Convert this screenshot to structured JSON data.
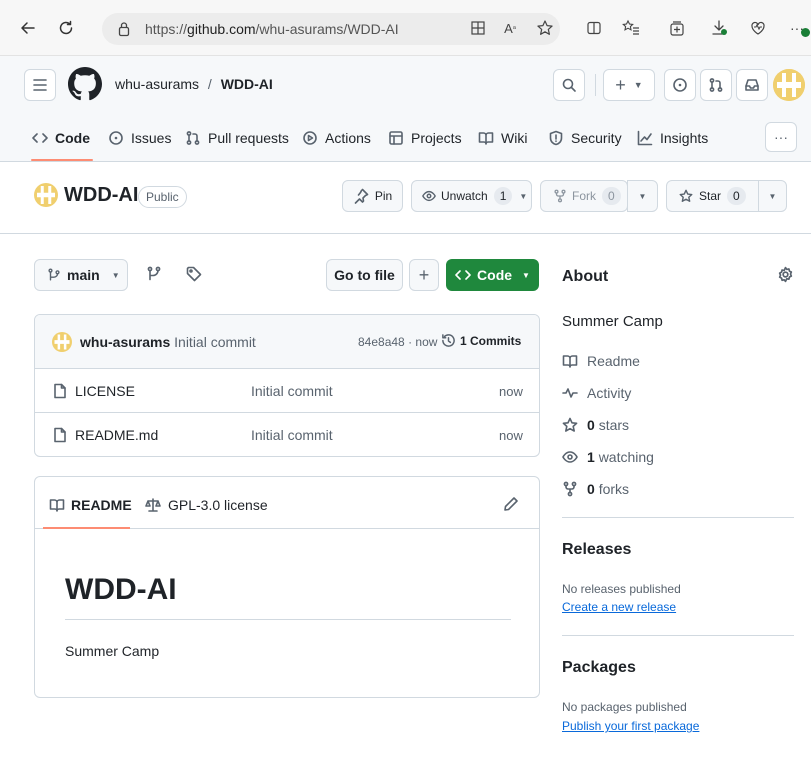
{
  "browser": {
    "url_prefix": "https://",
    "url_host": "github.com",
    "url_path": "/whu-asurams/WDD-AI"
  },
  "header": {
    "owner": "whu-asurams",
    "separator": "/",
    "repo": "WDD-AI"
  },
  "tabs": [
    {
      "label": "Code",
      "icon": "code-icon"
    },
    {
      "label": "Issues",
      "icon": "issue-icon"
    },
    {
      "label": "Pull requests",
      "icon": "pull-request-icon"
    },
    {
      "label": "Actions",
      "icon": "play-icon"
    },
    {
      "label": "Projects",
      "icon": "table-icon"
    },
    {
      "label": "Wiki",
      "icon": "book-icon"
    },
    {
      "label": "Security",
      "icon": "shield-icon"
    },
    {
      "label": "Insights",
      "icon": "graph-icon"
    }
  ],
  "repo": {
    "name": "WDD-AI",
    "visibility": "Public",
    "pin_label": "Pin",
    "unwatch_label": "Unwatch",
    "watch_count": "1",
    "fork_label": "Fork",
    "fork_count": "0",
    "star_label": "Star",
    "star_count": "0"
  },
  "toolbar": {
    "branch": "main",
    "go_to_file": "Go to file",
    "add_label": "+",
    "code_label": "Code"
  },
  "commit": {
    "author": "whu-asurams",
    "message": "Initial commit",
    "hash": "84e8a48",
    "dot": "·",
    "time": "now",
    "commits_label": "1 Commits"
  },
  "files": [
    {
      "name": "LICENSE",
      "message": "Initial commit",
      "time": "now"
    },
    {
      "name": "README.md",
      "message": "Initial commit",
      "time": "now"
    }
  ],
  "readme": {
    "tab_readme": "README",
    "tab_license": "GPL-3.0 license",
    "heading": "WDD-AI",
    "body": "Summer Camp"
  },
  "about": {
    "title": "About",
    "description": "Summer Camp",
    "readme": "Readme",
    "activity": "Activity",
    "stars_count": "0",
    "stars_label": "stars",
    "watching_count": "1",
    "watching_label": "watching",
    "forks_count": "0",
    "forks_label": "forks"
  },
  "releases": {
    "title": "Releases",
    "none": "No releases published",
    "create_link": "Create a new release"
  },
  "packages": {
    "title": "Packages",
    "none": "No packages published",
    "publish_link": "Publish your first package"
  },
  "colors": {
    "accent_underline": "#fd8c73",
    "code_button": "#1f883d",
    "link": "#0969da",
    "notification_dot": "#1a7f37"
  }
}
